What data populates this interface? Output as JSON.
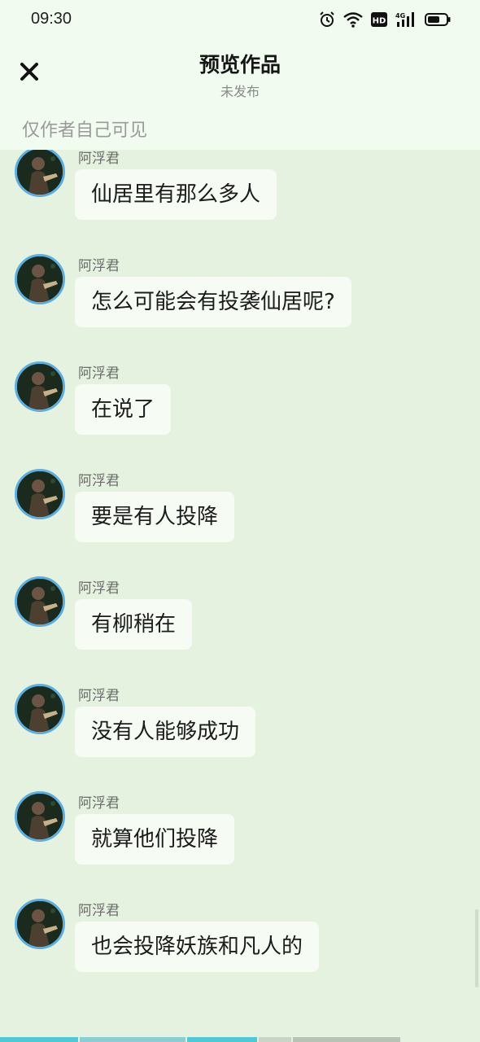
{
  "status_bar": {
    "time": "09:30",
    "icons": [
      "alarm-icon",
      "wifi-icon",
      "hd-icon",
      "signal-4g-icon",
      "battery-icon"
    ],
    "network_label": "4G",
    "hd_label": "HD"
  },
  "header": {
    "close_icon": "close-icon",
    "title": "预览作品",
    "subtitle": "未发布",
    "visibility_note": "仅作者自己可见"
  },
  "messages": [
    {
      "sender": "阿浮君",
      "text": "仙居里有那么多人"
    },
    {
      "sender": "阿浮君",
      "text": "怎么可能会有投袭仙居呢?"
    },
    {
      "sender": "阿浮君",
      "text": "在说了"
    },
    {
      "sender": "阿浮君",
      "text": "要是有人投降"
    },
    {
      "sender": "阿浮君",
      "text": "有柳稍在"
    },
    {
      "sender": "阿浮君",
      "text": "没有人能够成功"
    },
    {
      "sender": "阿浮君",
      "text": "就算他们投降"
    },
    {
      "sender": "阿浮君",
      "text": "也会投降妖族和凡人的"
    }
  ],
  "colors": {
    "background": "#e4f2df",
    "header_bg": "#f1fbf0",
    "bubble_bg": "#f6fbf4",
    "avatar_ring": "#5aaee0",
    "progress_played": "#4fc9d6"
  }
}
